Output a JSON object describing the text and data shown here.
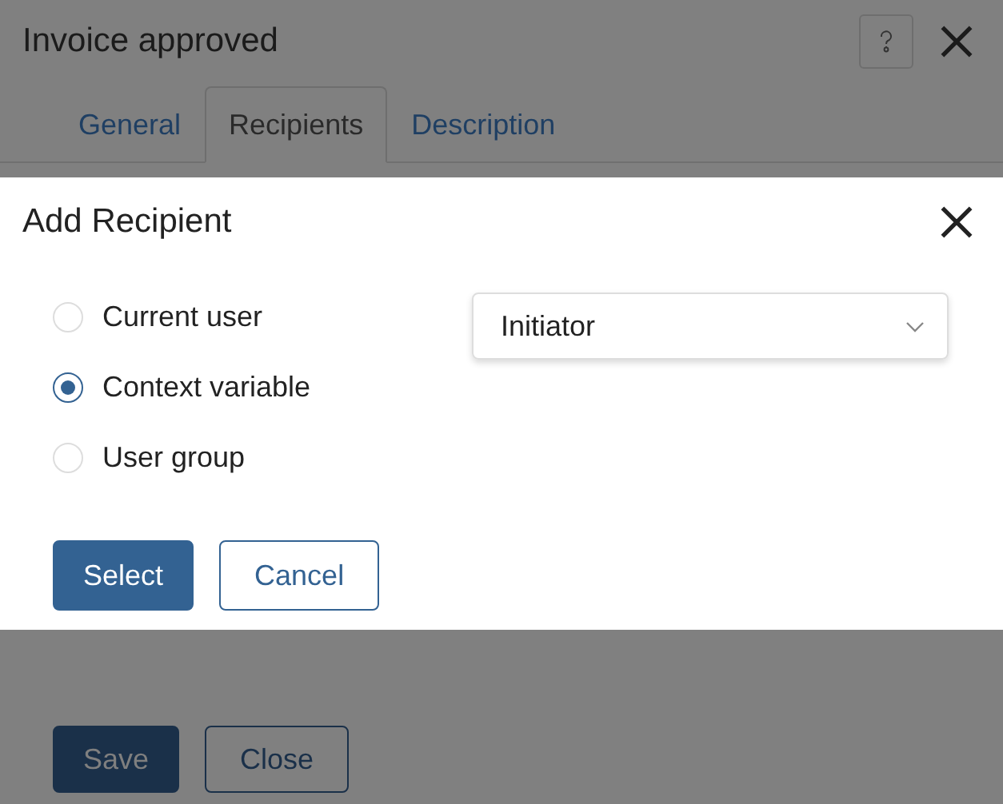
{
  "window": {
    "title": "Invoice approved"
  },
  "tabs": [
    {
      "label": "General",
      "selected": false
    },
    {
      "label": "Recipients",
      "selected": true
    },
    {
      "label": "Description",
      "selected": false
    }
  ],
  "dialog": {
    "title": "Add Recipient",
    "options": [
      {
        "label": "Current user",
        "selected": false
      },
      {
        "label": "Context variable",
        "selected": true
      },
      {
        "label": "User group",
        "selected": false
      }
    ],
    "dropdown": {
      "value": "Initiator"
    },
    "buttons": [
      {
        "label": "Select",
        "kind": "primary"
      },
      {
        "label": "Cancel",
        "kind": "secondary"
      }
    ]
  },
  "footer_buttons": [
    {
      "label": "Save",
      "kind": "primary"
    },
    {
      "label": "Close",
      "kind": "secondary"
    }
  ]
}
